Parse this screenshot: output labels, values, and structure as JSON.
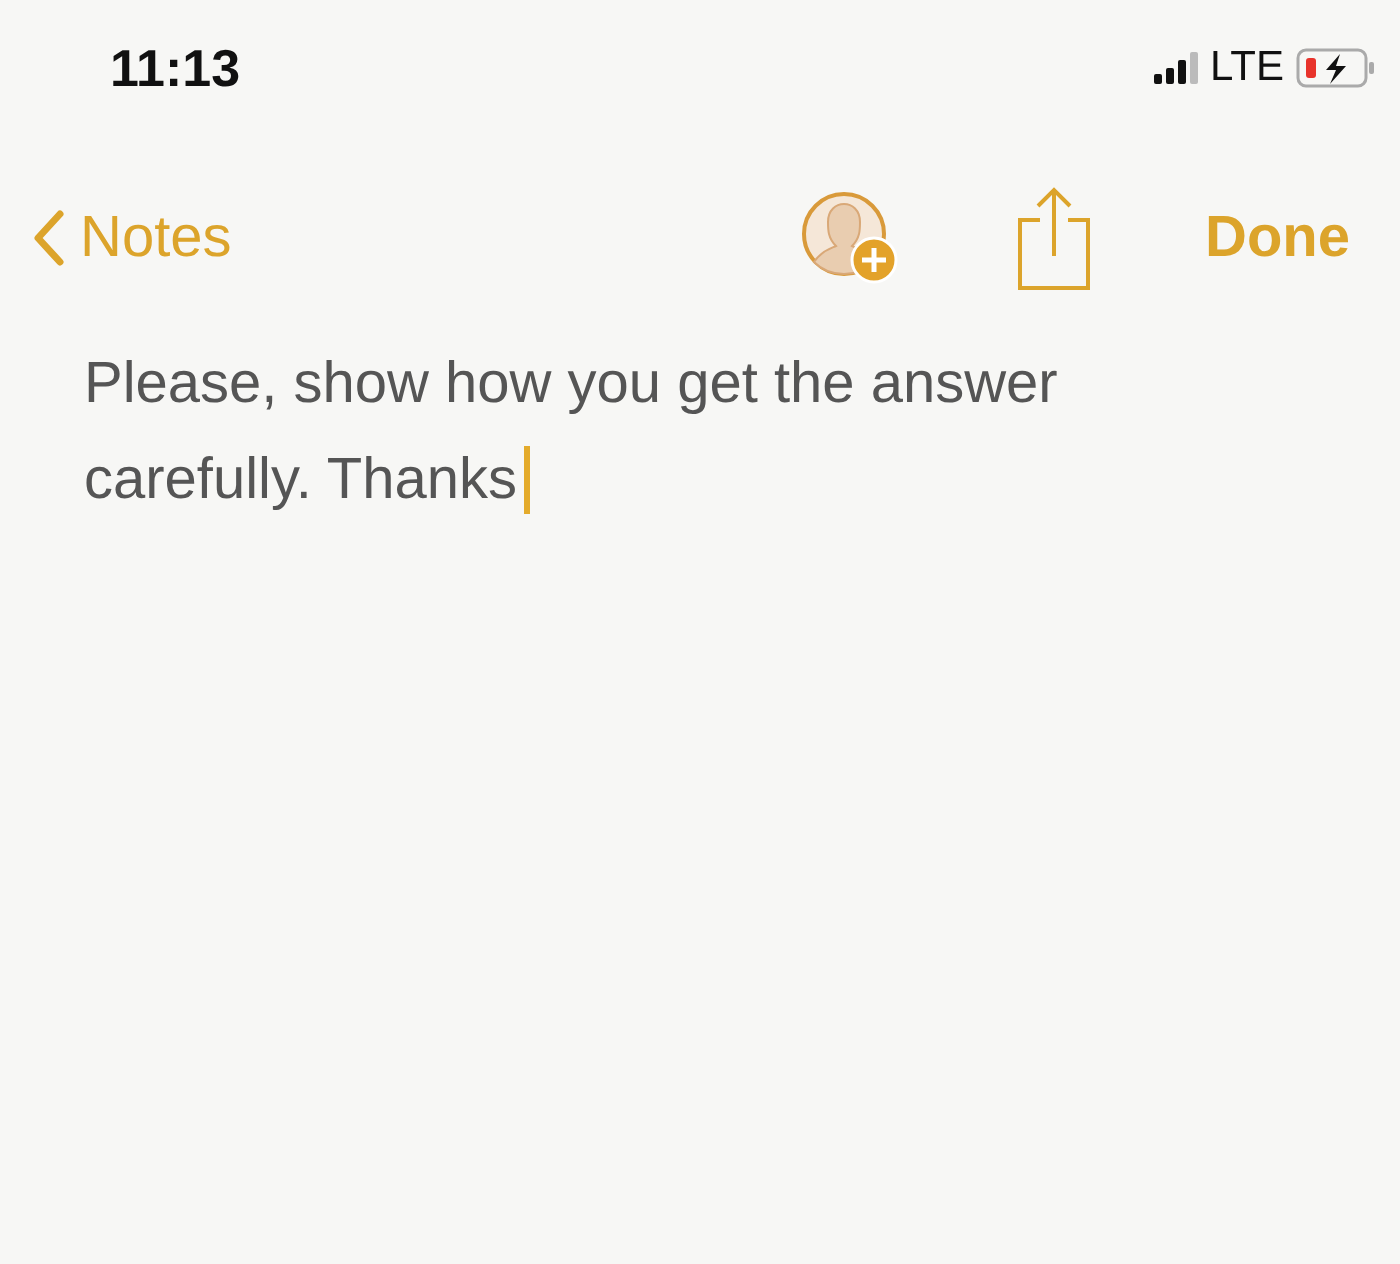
{
  "status_bar": {
    "time": "11:13",
    "network": "LTE"
  },
  "nav_bar": {
    "back_label": "Notes",
    "done_label": "Done"
  },
  "note": {
    "text": "Please, show how you get the answer carefully. Thanks"
  }
}
